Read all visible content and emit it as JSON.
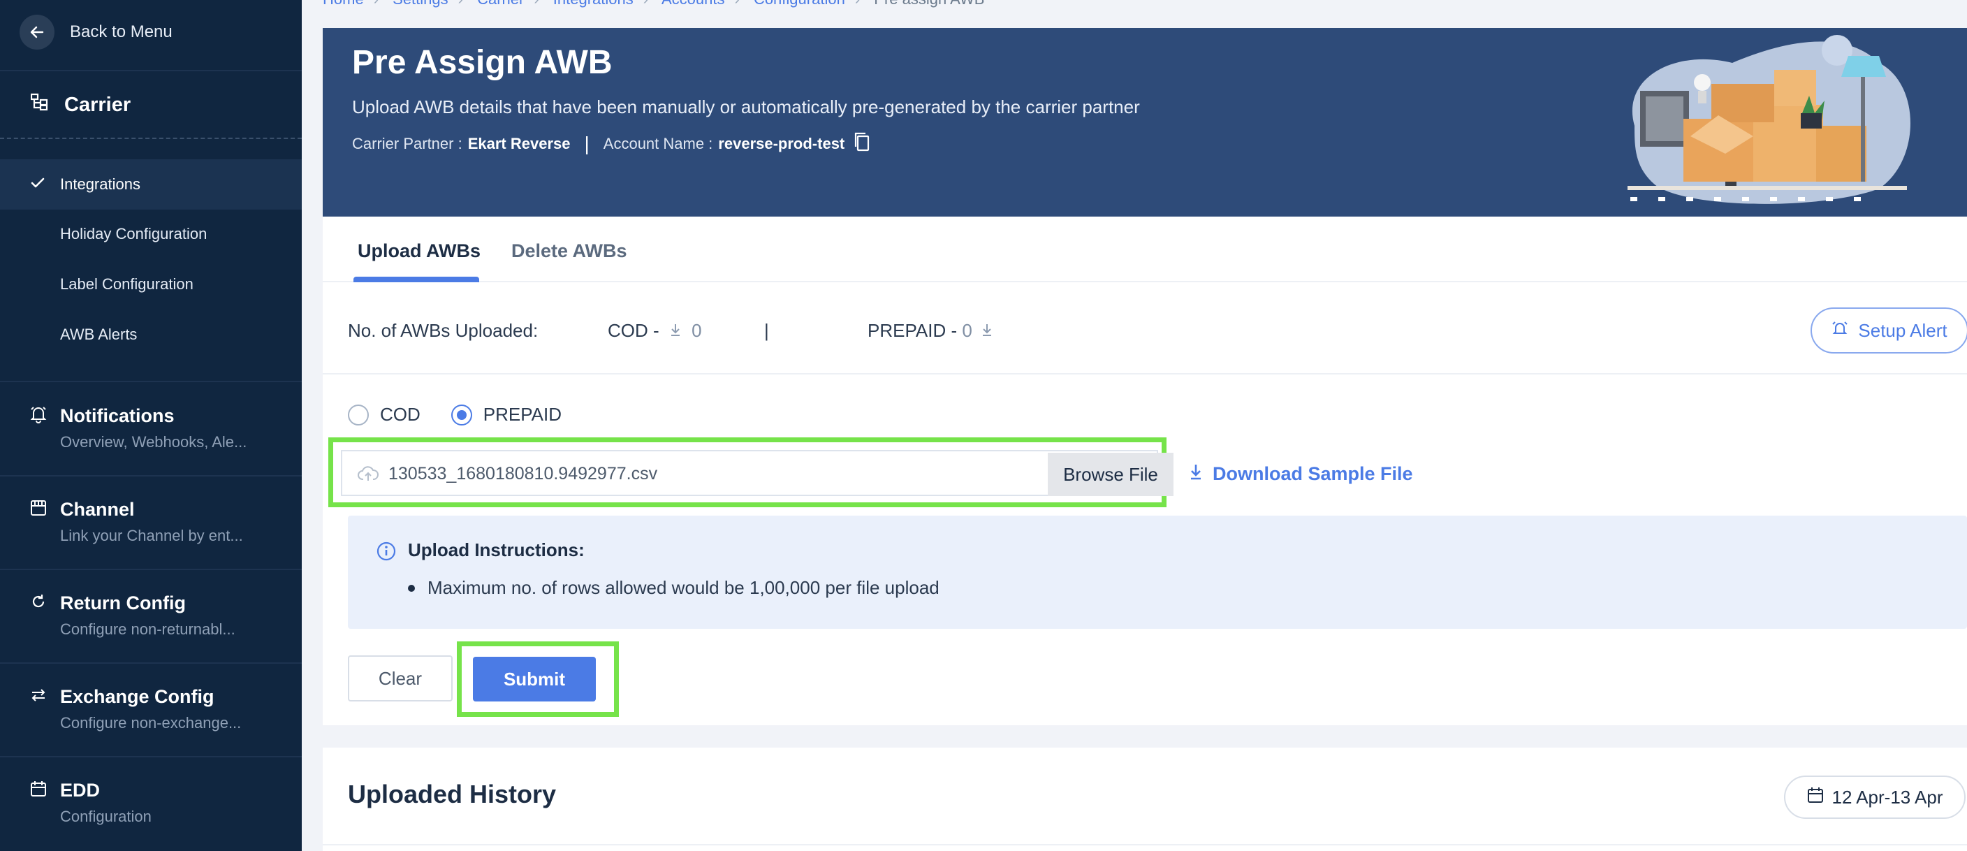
{
  "sidebar": {
    "back_label": "Back to Menu",
    "section_title": "Carrier",
    "sub_items": [
      "Integrations",
      "Holiday Configuration",
      "Label Configuration",
      "AWB Alerts"
    ],
    "groups": [
      {
        "title": "Notifications",
        "desc": "Overview, Webhooks, Ale...",
        "icon": "bell-icon"
      },
      {
        "title": "Channel",
        "desc": "Link your Channel by ent...",
        "icon": "store-icon"
      },
      {
        "title": "Return Config",
        "desc": "Configure non-returnabl...",
        "icon": "return-icon"
      },
      {
        "title": "Exchange Config",
        "desc": "Configure non-exchange...",
        "icon": "exchange-icon"
      },
      {
        "title": "EDD",
        "desc": "Configuration",
        "icon": "calendar-icon"
      }
    ]
  },
  "breadcrumb": [
    "Home",
    "Settings",
    "Carrier",
    "Integrations",
    "Accounts",
    "Configuration",
    "Pre assign AWB"
  ],
  "hero": {
    "title": "Pre Assign AWB",
    "subtitle": "Upload AWB details that have been manually or automatically pre-generated by the carrier partner",
    "partner_label": "Carrier Partner :",
    "partner_value": "Ekart Reverse",
    "account_label": "Account Name :",
    "account_value": "reverse-prod-test"
  },
  "tabs": {
    "upload": "Upload AWBs",
    "delete": "Delete AWBs"
  },
  "stats": {
    "label": "No. of AWBs Uploaded:",
    "cod_label": "COD -",
    "cod_value": "0",
    "separator": "|",
    "prepaid_label": "PREPAID -",
    "prepaid_value": "0"
  },
  "setup_alert": "Setup Alert",
  "payment": {
    "cod": "COD",
    "prepaid": "PREPAID",
    "selected": "PREPAID"
  },
  "file": {
    "name": "130533_1680180810.9492977.csv",
    "browse": "Browse File"
  },
  "download_sample": "Download Sample File",
  "instructions": {
    "heading": "Upload Instructions:",
    "items": [
      "Maximum no. of rows allowed would be 1,00,000 per file upload"
    ]
  },
  "actions": {
    "clear": "Clear",
    "submit": "Submit"
  },
  "history": {
    "title": "Uploaded History",
    "date_range": "12 Apr-13 Apr"
  },
  "colors": {
    "sidebar": "#102640",
    "hero": "#2e4b79",
    "accent": "#4b7be5",
    "highlight": "#76e34a"
  }
}
